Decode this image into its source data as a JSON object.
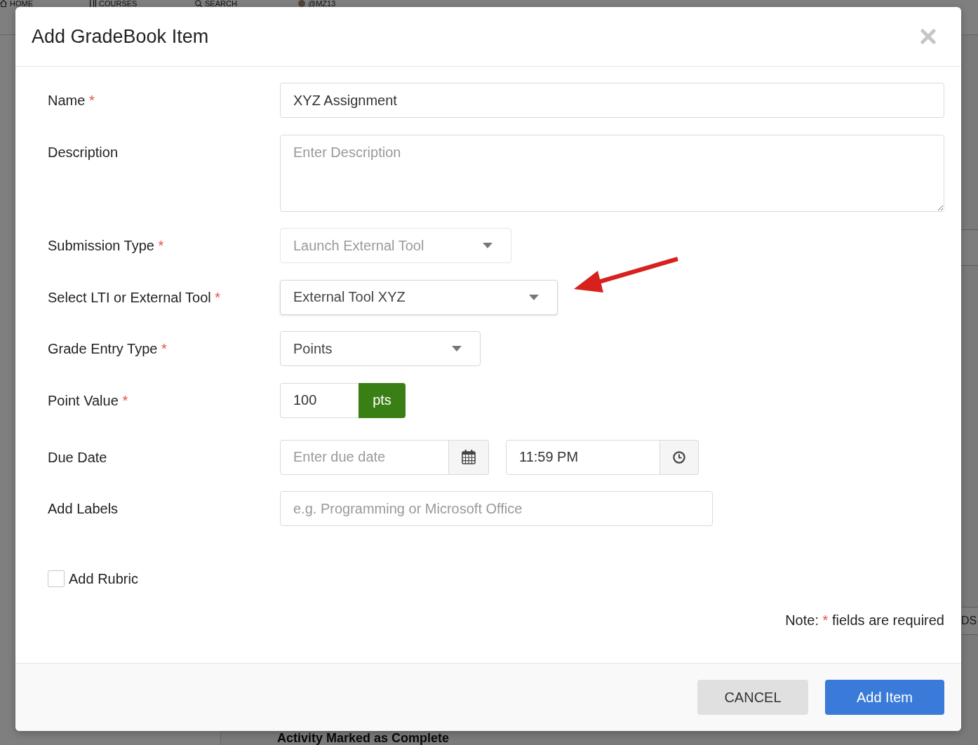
{
  "background_page": {
    "nav": [
      {
        "label": "HOME"
      },
      {
        "label": "COURSES"
      },
      {
        "label": "SEARCH"
      },
      {
        "label": "@MZ13"
      }
    ],
    "heading": "Activity Marked as Complete",
    "side_button": "DS"
  },
  "dialog": {
    "title": "Add GradeBook Item",
    "fields": [
      {
        "kind": "text",
        "label": "Name",
        "required_mark": "*",
        "value": "XYZ Assignment",
        "disabled": false
      },
      {
        "kind": "textarea",
        "label": "Description",
        "placeholder": "Enter Description",
        "disabled": false
      },
      {
        "kind": "select",
        "label": "Submission Type",
        "required_mark": "*",
        "value": "Launch External Tool",
        "disabled": true
      },
      {
        "kind": "select",
        "label": "Select LTI or External Tool",
        "required_mark": "*",
        "value": "External Tool XYZ",
        "disabled": false
      },
      {
        "kind": "select",
        "label": "Grade Entry Type",
        "required_mark": "*",
        "value": "Points",
        "disabled": false
      },
      {
        "kind": "number",
        "label": "Point Value",
        "required_mark": "*",
        "value": "100",
        "unit": "pts",
        "disabled": false
      },
      {
        "kind": "datetime",
        "label": "Due Date",
        "date_placeholder": "Enter due date",
        "time_value": "11:59 PM",
        "disabled": false
      },
      {
        "kind": "text",
        "label": "Add Labels",
        "placeholder": "e.g. Programming or Microsoft Office",
        "disabled": false
      }
    ],
    "rubric": {
      "label": "Add Rubric",
      "checked": false
    },
    "note": {
      "prefix": "Note:",
      "mark": "*",
      "suffix": "fields are required"
    },
    "buttons": [
      {
        "label": "CANCEL",
        "kind": "secondary"
      },
      {
        "label": "Add Item",
        "kind": "primary"
      }
    ]
  }
}
